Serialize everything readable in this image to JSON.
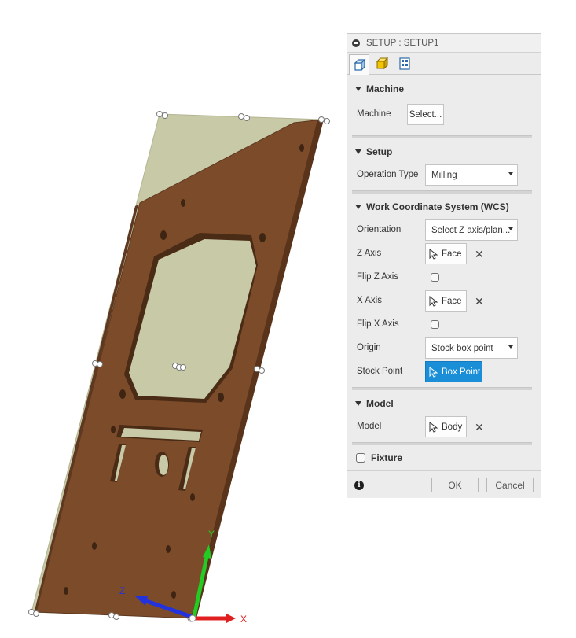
{
  "panel": {
    "title": "SETUP : SETUP1",
    "tabs": [
      {
        "name": "setup-tab",
        "icon": "setup-cube-icon"
      },
      {
        "name": "stock-tab",
        "icon": "stock-box-icon"
      },
      {
        "name": "post-process-tab",
        "icon": "post-process-icon"
      }
    ],
    "machine": {
      "heading": "Machine",
      "label": "Machine",
      "button": "Select..."
    },
    "setup": {
      "heading": "Setup",
      "operation_type_label": "Operation Type",
      "operation_type_value": "Milling"
    },
    "wcs": {
      "heading": "Work Coordinate System (WCS)",
      "orientation_label": "Orientation",
      "orientation_value": "Select Z axis/plan...",
      "z_axis_label": "Z Axis",
      "z_axis_value": "Face",
      "flip_z_label": "Flip Z Axis",
      "flip_z_checked": false,
      "x_axis_label": "X Axis",
      "x_axis_value": "Face",
      "flip_x_label": "Flip X Axis",
      "flip_x_checked": false,
      "origin_label": "Origin",
      "origin_value": "Stock box point",
      "stock_point_label": "Stock Point",
      "stock_point_value": "Box Point"
    },
    "model": {
      "heading": "Model",
      "label": "Model",
      "value": "Body"
    },
    "fixture": {
      "heading": "Fixture",
      "checked": false
    },
    "footer": {
      "ok": "OK",
      "cancel": "Cancel"
    }
  },
  "viewport": {
    "triad": {
      "x_label": "X",
      "y_label": "Y",
      "z_label": "Z",
      "x_color": "#e02020",
      "y_color": "#22cc22",
      "z_color": "#2233dd"
    },
    "part_color": "#7b4b2a",
    "stock_color": "#c8c9a6"
  },
  "colors": {
    "accent": "#1a8fd8",
    "panel_bg": "#ececec"
  }
}
